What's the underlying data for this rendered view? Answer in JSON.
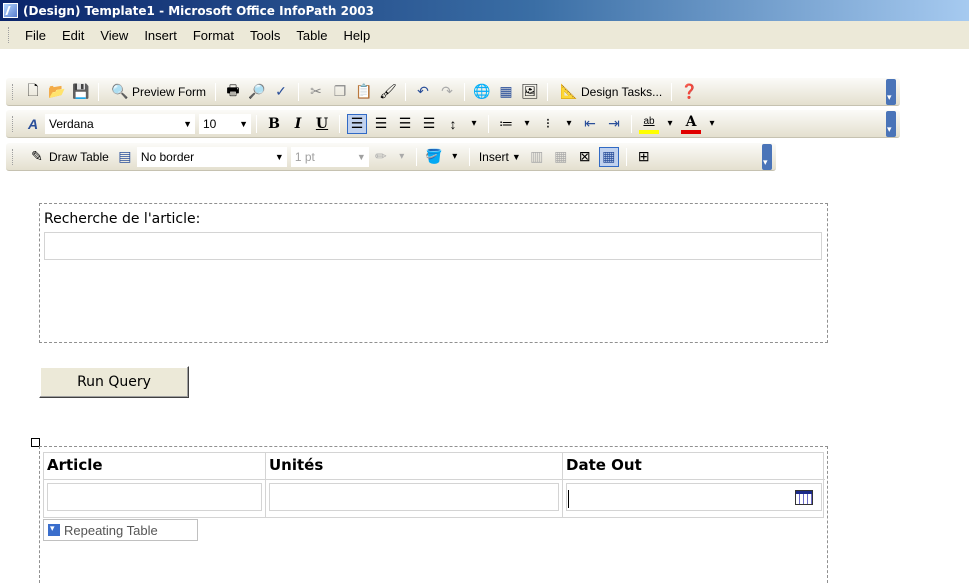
{
  "window": {
    "title": "(Design) Template1 - Microsoft Office InfoPath 2003"
  },
  "menu": [
    "File",
    "Edit",
    "View",
    "Insert",
    "Format",
    "Tools",
    "Table",
    "Help"
  ],
  "standard_toolbar": {
    "preview_label": "Preview Form",
    "design_tasks_label": "Design Tasks..."
  },
  "format_toolbar": {
    "font": "Verdana",
    "size": "10",
    "bold": "B",
    "italic": "I",
    "underline": "U",
    "font_color_letter": "A",
    "highlight_letter": "ab"
  },
  "table_toolbar": {
    "draw_table_label": "Draw Table",
    "border_style": "No border",
    "border_width": "1 pt",
    "insert_label": "Insert"
  },
  "form": {
    "search_label": "Recherche de l'article:",
    "run_query_label": "Run Query",
    "table_headers": [
      "Article",
      "Unités",
      "Date Out"
    ],
    "repeating_table_label": "Repeating Table"
  }
}
